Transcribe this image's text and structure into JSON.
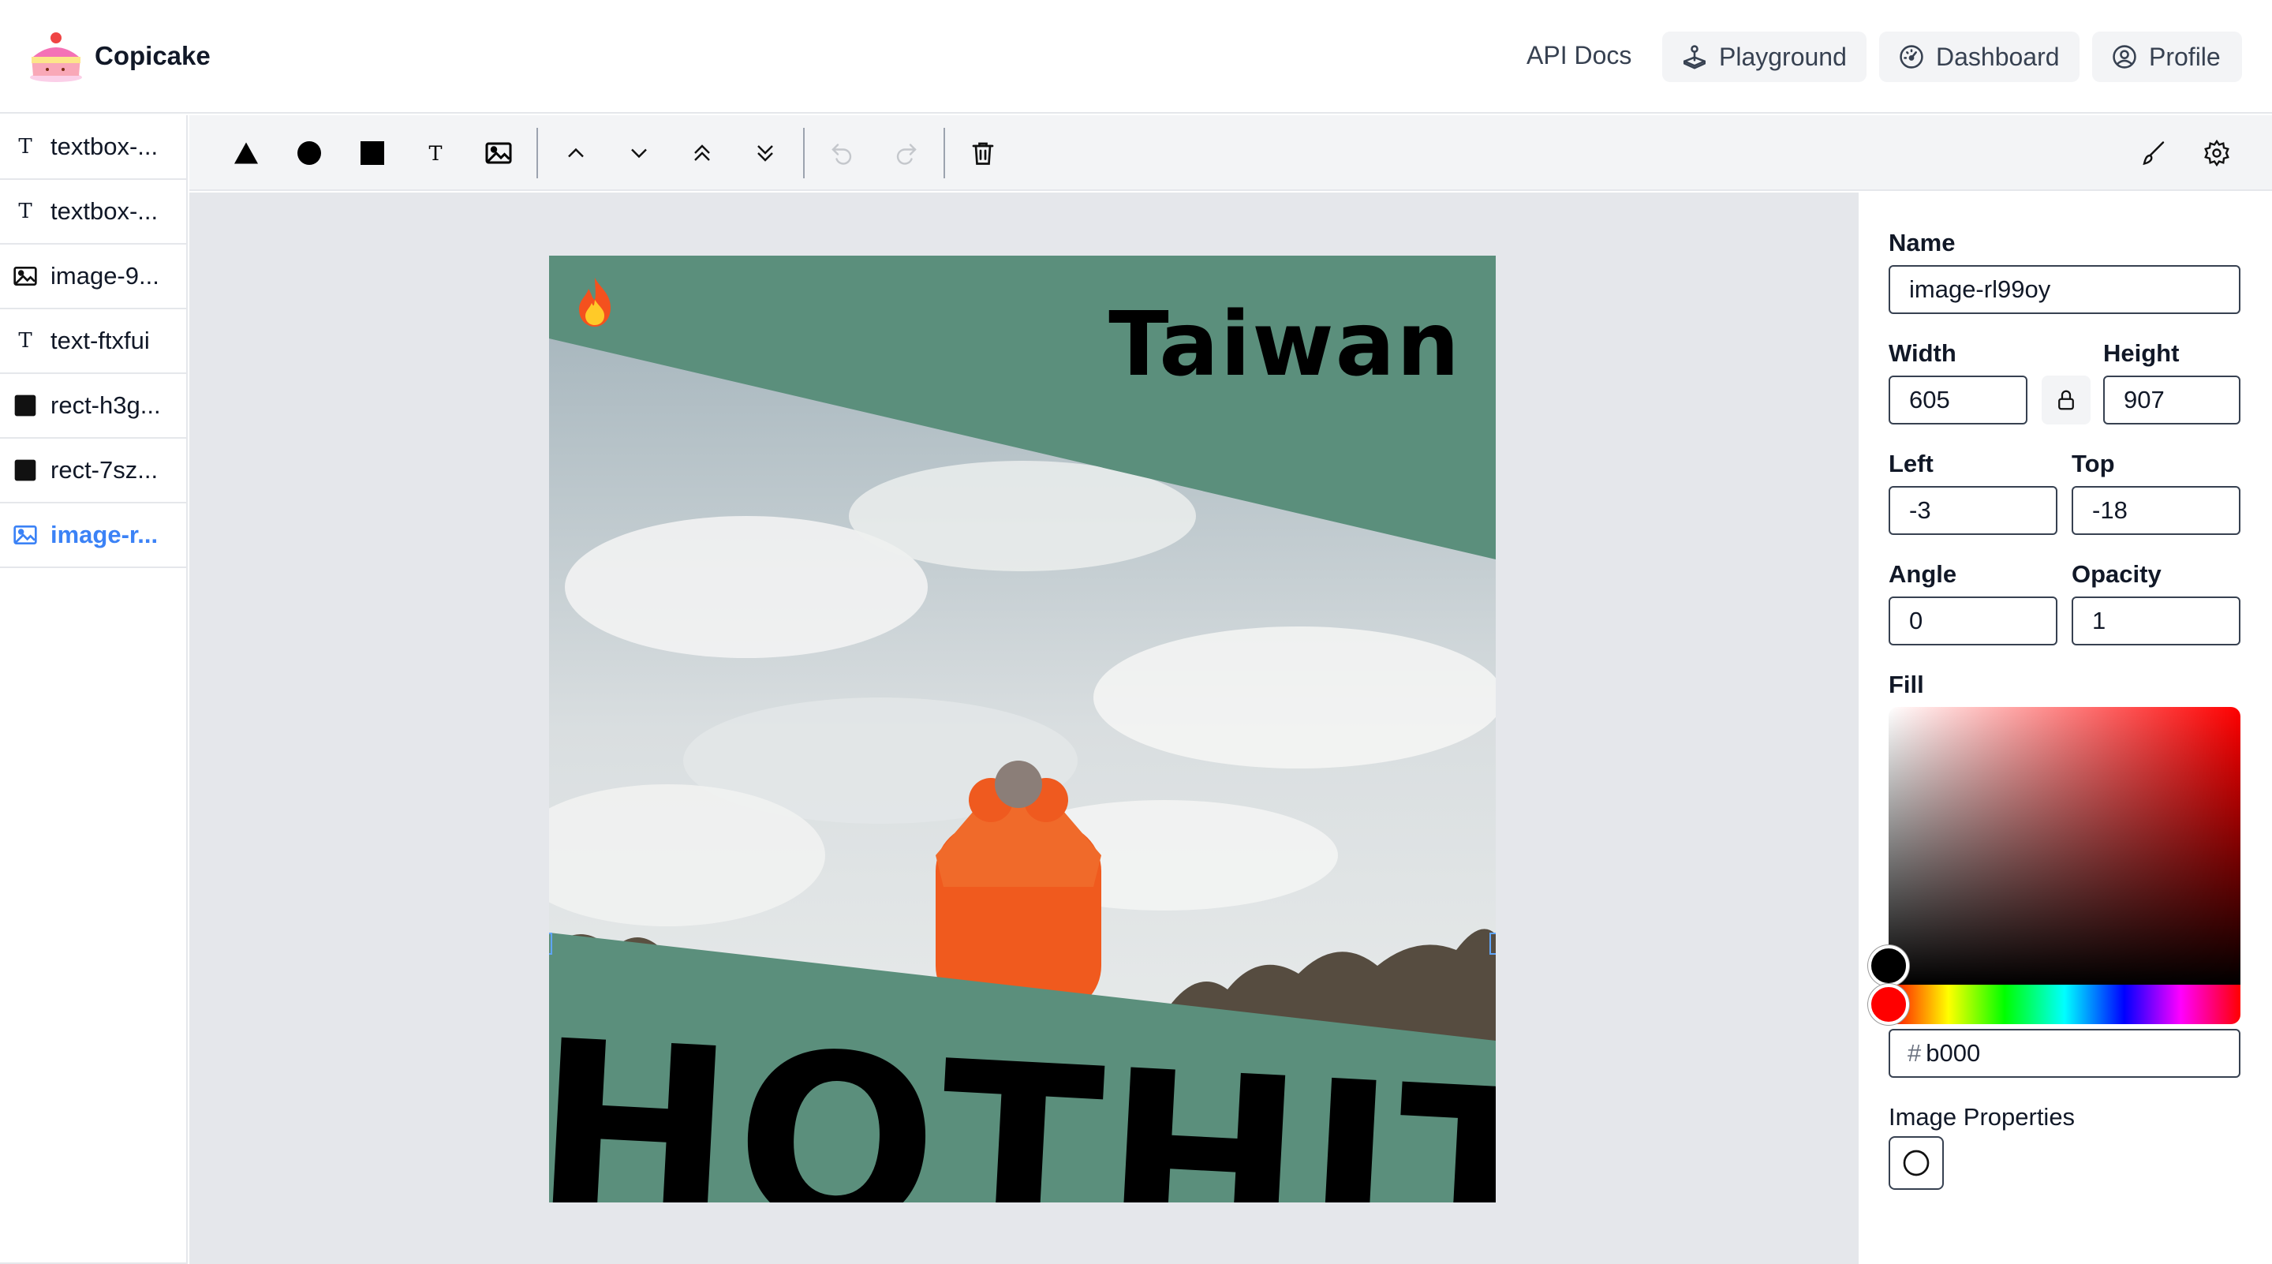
{
  "header": {
    "brand": "Copicake",
    "nav": {
      "api_docs": "API Docs",
      "playground": "Playground",
      "dashboard": "Dashboard",
      "profile": "Profile"
    }
  },
  "layers": [
    {
      "type": "text",
      "label": "textbox-..."
    },
    {
      "type": "text",
      "label": "textbox-..."
    },
    {
      "type": "image",
      "label": "image-9..."
    },
    {
      "type": "text",
      "label": "text-ftxfui"
    },
    {
      "type": "rect",
      "label": "rect-h3g..."
    },
    {
      "type": "rect",
      "label": "rect-7sz..."
    },
    {
      "type": "image",
      "label": "image-r...",
      "active": true
    }
  ],
  "toolbar": {
    "tools": [
      "triangle-icon",
      "circle-icon",
      "square-icon",
      "text-icon",
      "image-icon"
    ],
    "arrange": [
      "chevron-up-icon",
      "chevron-down-icon",
      "chevrons-up-icon",
      "chevrons-down-icon"
    ],
    "history": [
      "undo-icon",
      "redo-icon"
    ],
    "delete": "trash-icon",
    "right": [
      "brush-icon",
      "gear-icon"
    ]
  },
  "artboard": {
    "title": "Taiwan",
    "banner_text": "HOTHITS",
    "background_color": "#5b8f7c",
    "emoji": "🔥"
  },
  "properties": {
    "name_label": "Name",
    "name_value": "image-rl99oy",
    "width_label": "Width",
    "width_value": "605",
    "height_label": "Height",
    "height_value": "907",
    "left_label": "Left",
    "left_value": "-3",
    "top_label": "Top",
    "top_value": "-18",
    "angle_label": "Angle",
    "angle_value": "0",
    "opacity_label": "Opacity",
    "opacity_value": "1",
    "fill_label": "Fill",
    "hex_prefix": "#",
    "hex_value": "b000",
    "image_properties_label": "Image Properties"
  },
  "colors": {
    "accent": "#3b82f6",
    "artboard_green": "#5b8f7c",
    "jacket_orange": "#f05a1e"
  }
}
